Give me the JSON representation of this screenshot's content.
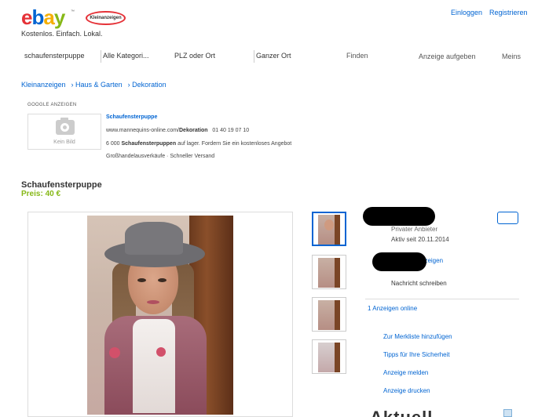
{
  "header": {
    "logo": {
      "e": "e",
      "b": "b",
      "a": "a",
      "y": "y"
    },
    "badge": "Kleinanzeigen",
    "tagline": "Kostenlos. Einfach. Lokal.",
    "login": "Einloggen",
    "register": "Registrieren"
  },
  "search": {
    "query": "schaufensterpuppe",
    "category": "Alle Kategori...",
    "location": "PLZ oder Ort",
    "radius": "Ganzer Ort",
    "find": "Finden",
    "post_ad": "Anzeige aufgeben",
    "mine": "Meins"
  },
  "breadcrumb": [
    "Kleinanzeigen",
    "Haus & Garten",
    "Dekoration"
  ],
  "google_ad": {
    "label": "GOOGLE ANZEIGEN",
    "no_image": "Kein Bild",
    "title": "Schaufensterpuppe",
    "url_prefix": "www.mannequins-online.com/",
    "url_bold": "Dekoration",
    "phone": "01 40 19 07 10",
    "desc_prefix": "6 000",
    "desc_bold": "Schaufensterpuppen",
    "desc_rest": "auf lager. Fordern Sie ein kostenloses Angebot",
    "sub": "Großhandelausverkäufe · Schneller Versand"
  },
  "listing": {
    "title": "Schaufensterpuppe",
    "price": "Preis: 40 €"
  },
  "seller": {
    "type": "Privater Anbieter",
    "since": "Aktiv seit 20.11.2014",
    "more_ads_suffix": "nzeigen",
    "message": "Nachricht schreiben",
    "online": "1 Anzeigen online"
  },
  "actions": [
    "Zur Merkliste hinzufügen",
    "Tipps für Ihre Sicherheit",
    "Anzeige melden",
    "Anzeige drucken"
  ],
  "footer": {
    "partial_heading": "Aktuell"
  },
  "colors": {
    "ebay_red": "#e53238",
    "ebay_blue": "#0064d2",
    "ebay_yellow": "#f5af02",
    "ebay_green": "#86b817"
  }
}
